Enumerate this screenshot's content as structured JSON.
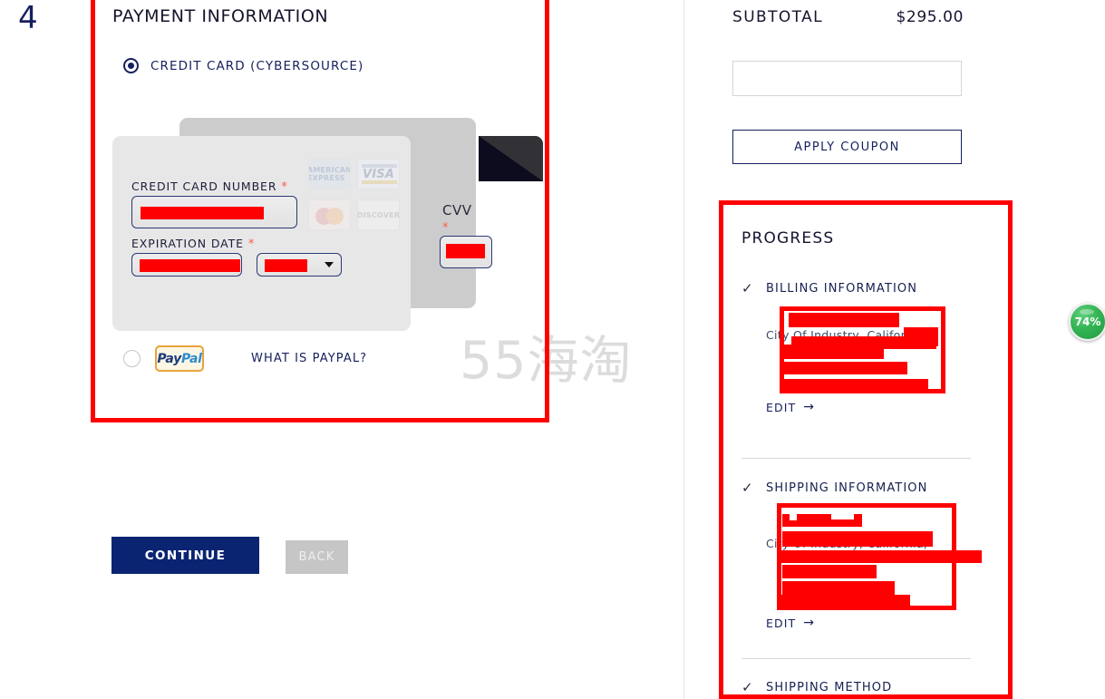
{
  "step": {
    "number": "4"
  },
  "payment": {
    "title": "PAYMENT INFORMATION",
    "methods": [
      {
        "label": "CREDIT CARD (CYBERSOURCE)",
        "selected": true
      },
      {
        "label": "PayPal",
        "selected": false
      }
    ],
    "card_fields": {
      "number_label": "CREDIT CARD NUMBER",
      "expiration_label": "EXPIRATION DATE",
      "cvv_label": "CVV",
      "required_marker": "*",
      "number_value": "",
      "expiration_month_value": "",
      "expiration_year_value": "",
      "cvv_value": ""
    },
    "accepted_cards": [
      {
        "name": "amex",
        "text": "AMERICAN EXPRESS"
      },
      {
        "name": "visa",
        "text": "VISA"
      },
      {
        "name": "mastercard",
        "text": "MasterCard"
      },
      {
        "name": "discover",
        "text": "DISCOVER"
      }
    ],
    "paypal": {
      "logo_part1": "Pay",
      "logo_part2": "Pal",
      "help_link": "WHAT IS PAYPAL?"
    }
  },
  "actions": {
    "continue_label": "CONTINUE",
    "back_label": "BACK"
  },
  "watermark": {
    "text": "55海淘"
  },
  "sidebar": {
    "subtotal_label": "SUBTOTAL",
    "subtotal_value": "$295.00",
    "coupon_value": "",
    "coupon_placeholder": "",
    "apply_coupon_label": "APPLY COUPON",
    "progress_title": "PROGRESS",
    "progress_items": [
      {
        "label": "BILLING INFORMATION",
        "checked": true,
        "check_glyph": "✓",
        "details": "City Of Industry, California,",
        "edit_label": "EDIT",
        "edit_arrow": "→",
        "redacted": true
      },
      {
        "label": "SHIPPING INFORMATION",
        "checked": true,
        "check_glyph": "✓",
        "details": "City Of Industry, California,",
        "edit_label": "EDIT",
        "edit_arrow": "→",
        "redacted": true
      },
      {
        "label": "SHIPPING METHOD",
        "checked": true,
        "check_glyph": "✓",
        "details": "",
        "edit_label": "",
        "edit_arrow": "",
        "redacted": false
      }
    ]
  },
  "score_badge": {
    "value": "74%"
  },
  "colors": {
    "annotation_red": "#ff0000",
    "brand_navy": "#16205e",
    "continue_blue": "#0b2472",
    "badge_green": "#34b454"
  }
}
